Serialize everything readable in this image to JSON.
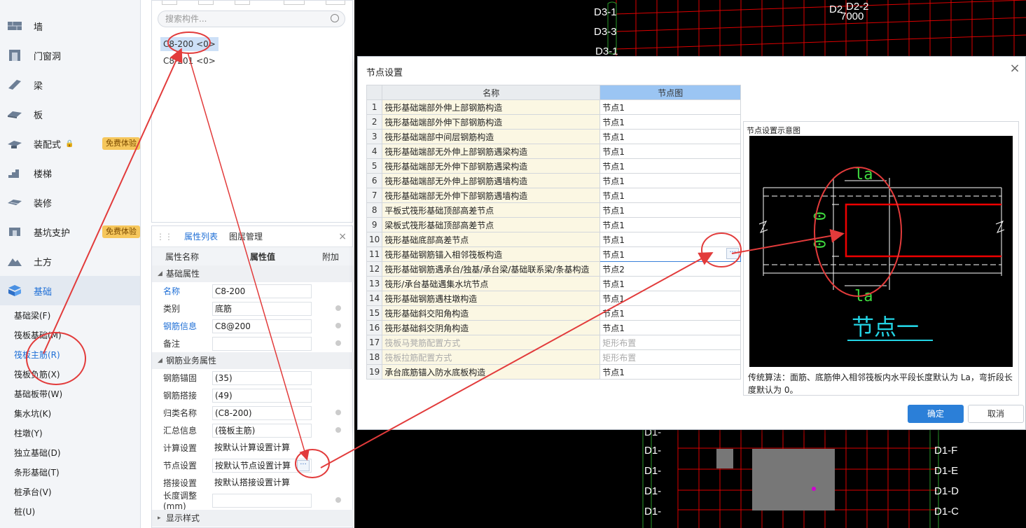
{
  "sidebar": {
    "categories": [
      {
        "label": "墙",
        "icon": "wall-icon"
      },
      {
        "label": "门窗洞",
        "icon": "door-window-icon"
      },
      {
        "label": "梁",
        "icon": "beam-icon"
      },
      {
        "label": "板",
        "icon": "slab-icon"
      },
      {
        "label": "装配式",
        "icon": "prefab-icon",
        "badge": "免费体验"
      },
      {
        "label": "楼梯",
        "icon": "stair-icon"
      },
      {
        "label": "装修",
        "icon": "decoration-icon"
      },
      {
        "label": "基坑支护",
        "icon": "pit-support-icon",
        "badge": "免费体验"
      },
      {
        "label": "土方",
        "icon": "earthwork-icon"
      },
      {
        "label": "基础",
        "icon": "foundation-icon"
      }
    ],
    "subitems": [
      "基础梁(F)",
      "筏板基础(M)",
      "筏板主筋(R)",
      "筏板负筋(X)",
      "基础板带(W)",
      "集水坑(K)",
      "柱墩(Y)",
      "独立基础(D)",
      "条形基础(T)",
      "桩承台(V)",
      "桩(U)"
    ]
  },
  "component_list": {
    "search_placeholder": "搜索构件...",
    "items": [
      "C8-200 <0>",
      "C8-201 <0>"
    ]
  },
  "properties": {
    "tabs": [
      "属性列表",
      "图层管理"
    ],
    "headers": [
      "属性名称",
      "属性值",
      "附加"
    ],
    "group1": "基础属性",
    "rows1": [
      {
        "k": "名称",
        "v": "C8-200"
      },
      {
        "k": "类别",
        "v": "底筋"
      },
      {
        "k": "钢筋信息",
        "v": "C8@200"
      },
      {
        "k": "备注",
        "v": ""
      }
    ],
    "group2": "钢筋业务属性",
    "rows2": [
      {
        "k": "钢筋锚固",
        "v": "(35)"
      },
      {
        "k": "钢筋搭接",
        "v": "(49)"
      },
      {
        "k": "归类名称",
        "v": "(C8-200)"
      },
      {
        "k": "汇总信息",
        "v": "(筏板主筋)"
      },
      {
        "k": "计算设置",
        "v": "按默认计算设置计算"
      },
      {
        "k": "节点设置",
        "v": "按默认节点设置计算"
      },
      {
        "k": "搭接设置",
        "v": "按默认搭接设置计算"
      },
      {
        "k": "长度调整(mm)",
        "v": ""
      }
    ],
    "group3": "显示样式"
  },
  "dialog": {
    "title": "节点设置",
    "col_name": "名称",
    "col_node": "节点图",
    "rows": [
      {
        "n": "1",
        "name": "筏形基础端部外伸上部钢筋构造",
        "node": "节点1"
      },
      {
        "n": "2",
        "name": "筏形基础端部外伸下部钢筋构造",
        "node": "节点1"
      },
      {
        "n": "3",
        "name": "筏形基础端部中间层钢筋构造",
        "node": "节点1"
      },
      {
        "n": "4",
        "name": "筏形基础端部无外伸上部钢筋遇梁构造",
        "node": "节点1"
      },
      {
        "n": "5",
        "name": "筏形基础端部无外伸下部钢筋遇梁构造",
        "node": "节点1"
      },
      {
        "n": "6",
        "name": "筏形基础端部无外伸上部钢筋遇墙构造",
        "node": "节点1"
      },
      {
        "n": "7",
        "name": "筏形基础端部无外伸下部钢筋遇墙构造",
        "node": "节点1"
      },
      {
        "n": "8",
        "name": "平板式筏形基础顶部高差节点",
        "node": "节点1"
      },
      {
        "n": "9",
        "name": "梁板式筏形基础顶部高差节点",
        "node": "节点1"
      },
      {
        "n": "10",
        "name": "筏形基础底部高差节点",
        "node": "节点1"
      },
      {
        "n": "11",
        "name": "筏形基础钢筋锚入相邻筏板构造",
        "node": "节点1"
      },
      {
        "n": "12",
        "name": "筏形基础钢筋遇承台/独基/承台梁/基础联系梁/条基构造",
        "node": "节点2"
      },
      {
        "n": "13",
        "name": "筏形/承台基础遇集水坑节点",
        "node": "节点1"
      },
      {
        "n": "14",
        "name": "筏形基础钢筋遇柱墩构造",
        "node": "节点1"
      },
      {
        "n": "15",
        "name": "筏形基础斜交阳角构造",
        "node": "节点1"
      },
      {
        "n": "16",
        "name": "筏形基础斜交阴角构造",
        "node": "节点1"
      },
      {
        "n": "17",
        "name": "筏板马凳筋配置方式",
        "node": "矩形布置"
      },
      {
        "n": "18",
        "name": "筏板拉筋配置方式",
        "node": "矩形布置"
      },
      {
        "n": "19",
        "name": "承台底筋锚入防水底板构造",
        "node": "节点1"
      }
    ],
    "preview_title": "节点设置示意图",
    "preview_caption": "节点一",
    "preview_la_top": "la",
    "preview_la_bottom": "la",
    "preview_zero": "0",
    "description": "传统算法：面筋、底筋伸入相邻筏板内水平段长度默认为 La，弯折段长度默认为 0。",
    "ok": "确定",
    "cancel": "取消"
  },
  "cad_labels": {
    "top": [
      "D3-1",
      "D3-3",
      "D3-1",
      "D2",
      "D2-2",
      "7000"
    ],
    "bottom": [
      "D1-",
      "D1-",
      "D1-",
      "D1-",
      "D1-",
      "D1-F",
      "D1-E",
      "D1-D",
      "D1-C"
    ]
  }
}
